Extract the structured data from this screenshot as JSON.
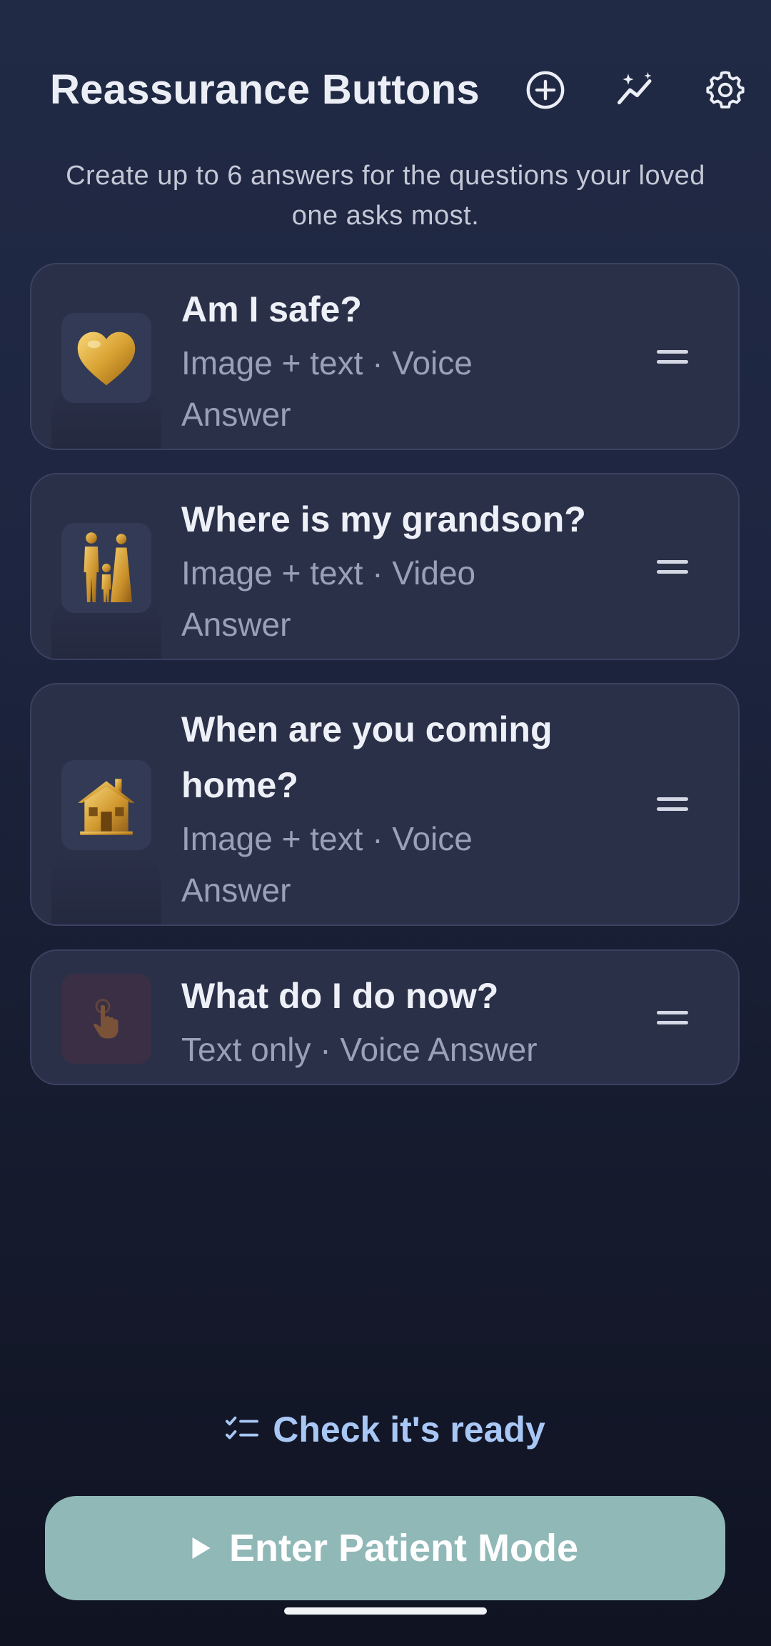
{
  "header": {
    "title": "Reassurance Buttons",
    "add_icon": "add-circle-icon",
    "insights_icon": "sparkle-trend-icon",
    "settings_icon": "gear-icon"
  },
  "subtitle": "Create up to 6 answers for the questions your loved one asks most.",
  "cards": [
    {
      "title": "Am I safe?",
      "meta_line1": "Image + text · Voice",
      "meta_line2": "Answer",
      "icon": "golden-heart-icon"
    },
    {
      "title": "Where is my grandson?",
      "meta_line1": "Image + text · Video",
      "meta_line2": "Answer",
      "icon": "golden-family-icon"
    },
    {
      "title_line1": "When are you coming",
      "title_line2": "home?",
      "meta_line1": "Image + text · Voice",
      "meta_line2": "Answer",
      "icon": "golden-house-icon"
    },
    {
      "title": "What do I do now?",
      "meta_line1": "Text only · Voice Answer",
      "icon": "tap-hand-icon"
    }
  ],
  "check_ready": {
    "label": "Check it's ready",
    "icon": "checklist-icon"
  },
  "enter_button": {
    "label": "Enter Patient Mode",
    "icon": "play-icon"
  },
  "colors": {
    "accent_link": "#a8c7f5",
    "primary_button": "#8fb8b7",
    "card_bg": "#2a3048",
    "background_top": "#212a44",
    "background_bottom": "#0f1322"
  }
}
